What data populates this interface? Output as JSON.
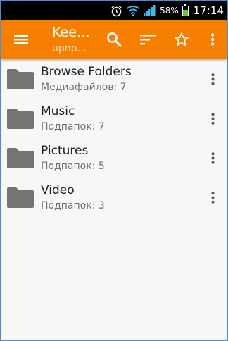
{
  "status_bar": {
    "icons": [
      "alarm-icon",
      "wifi-icon",
      "signal-icon"
    ],
    "battery_percent": "58%",
    "battery_level": 0.58,
    "time": "17:14"
  },
  "toolbar": {
    "title": "Kee…",
    "subtitle": "upnp…",
    "color": "#f77f00",
    "icons": [
      "menu-icon",
      "search-icon",
      "sort-icon",
      "star-icon",
      "more-vert-icon"
    ]
  },
  "list": {
    "items": [
      {
        "title": "Browse Folders",
        "subtitle": "Медиафайлов: 7"
      },
      {
        "title": "Music",
        "subtitle": "Подпапок: 7"
      },
      {
        "title": "Pictures",
        "subtitle": "Подпапок: 5"
      },
      {
        "title": "Video",
        "subtitle": "Подпапок: 3"
      }
    ]
  }
}
